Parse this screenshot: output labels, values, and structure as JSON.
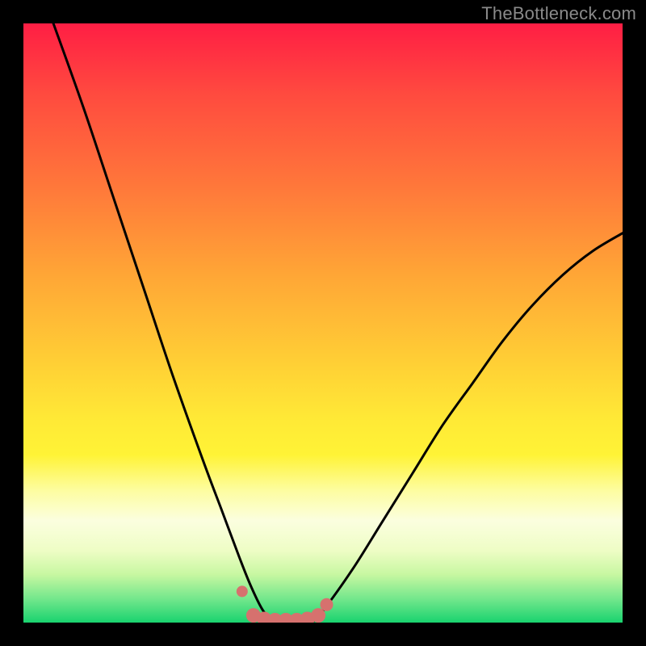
{
  "attribution": "TheBottleneck.com",
  "chart_data": {
    "type": "line",
    "title": "",
    "xlabel": "",
    "ylabel": "",
    "xlim": [
      0,
      100
    ],
    "ylim": [
      0,
      100
    ],
    "series": [
      {
        "name": "bottleneck-curve",
        "x": [
          5,
          10,
          15,
          20,
          25,
          30,
          33,
          36,
          38,
          40,
          42,
          44,
          46,
          48,
          50,
          55,
          60,
          65,
          70,
          75,
          80,
          85,
          90,
          95,
          100
        ],
        "y": [
          100,
          86,
          71,
          56,
          41,
          27,
          19,
          11,
          6,
          2,
          0,
          0,
          0,
          0,
          2,
          9,
          17,
          25,
          33,
          40,
          47,
          53,
          58,
          62,
          65
        ]
      }
    ],
    "markers": {
      "name": "trough-markers",
      "color": "#d6716e",
      "x": [
        36.5,
        38.4,
        40.2,
        42.0,
        43.8,
        45.6,
        47.4,
        49.2,
        50.6
      ],
      "y": [
        5.2,
        1.2,
        0.6,
        0.4,
        0.4,
        0.4,
        0.6,
        1.2,
        3.0
      ],
      "r": [
        7,
        9,
        9,
        9,
        9,
        9,
        9,
        9,
        8
      ]
    },
    "gradient_stops": [
      {
        "pos": 0,
        "color": "#ff1e44"
      },
      {
        "pos": 12,
        "color": "#ff4b3f"
      },
      {
        "pos": 28,
        "color": "#ff7a3a"
      },
      {
        "pos": 42,
        "color": "#ffa636"
      },
      {
        "pos": 58,
        "color": "#ffd335"
      },
      {
        "pos": 66,
        "color": "#ffe936"
      },
      {
        "pos": 72,
        "color": "#fff336"
      },
      {
        "pos": 78,
        "color": "#fdfda1"
      },
      {
        "pos": 83,
        "color": "#fbfedf"
      },
      {
        "pos": 88,
        "color": "#eefdc5"
      },
      {
        "pos": 92,
        "color": "#c7f7a1"
      },
      {
        "pos": 96,
        "color": "#74e78c"
      },
      {
        "pos": 100,
        "color": "#19d36f"
      }
    ]
  }
}
